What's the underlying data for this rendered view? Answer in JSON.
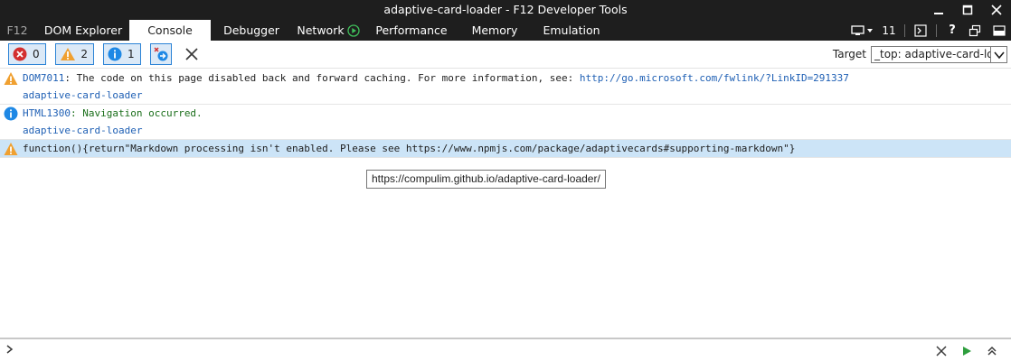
{
  "window": {
    "title": "adaptive-card-loader - F12 Developer Tools"
  },
  "tabs": [
    {
      "label": "F12"
    },
    {
      "label": "DOM Explorer"
    },
    {
      "label": "Console"
    },
    {
      "label": "Debugger"
    },
    {
      "label": "Network"
    },
    {
      "label": "Performance"
    },
    {
      "label": "Memory"
    },
    {
      "label": "Emulation"
    }
  ],
  "right_cluster": {
    "instance_count": "11",
    "help": "?"
  },
  "toolbar": {
    "errors_count": "0",
    "warnings_count": "2",
    "info_count": "1",
    "target_label": "Target",
    "target_value": "_top: adaptive-card-loader"
  },
  "messages": [
    {
      "level": "warning",
      "code": "DOM7011",
      "text": ": The code on this page disabled back and forward caching. For more information, see: ",
      "link": "http://go.microsoft.com/fwlink/?LinkID=291337",
      "source": "adaptive-card-loader"
    },
    {
      "level": "info",
      "code": "HTML1300",
      "text": ": Navigation occurred.",
      "source": "adaptive-card-loader"
    },
    {
      "level": "warning",
      "text": "function(){return\"Markdown processing isn't enabled. Please see https://www.npmjs.com/package/adaptivecards#supporting-markdown\"}"
    }
  ],
  "tooltip": {
    "text": "https://compulim.github.io/adaptive-card-loader/"
  },
  "console_input": {
    "value": ""
  },
  "colors": {
    "chrome": "#1e1e1e",
    "accent_blue": "#2b83d6",
    "warning": "#f0a030",
    "error": "#d32f2f",
    "info": "#1e88e5",
    "run_green": "#2e9e3e"
  }
}
